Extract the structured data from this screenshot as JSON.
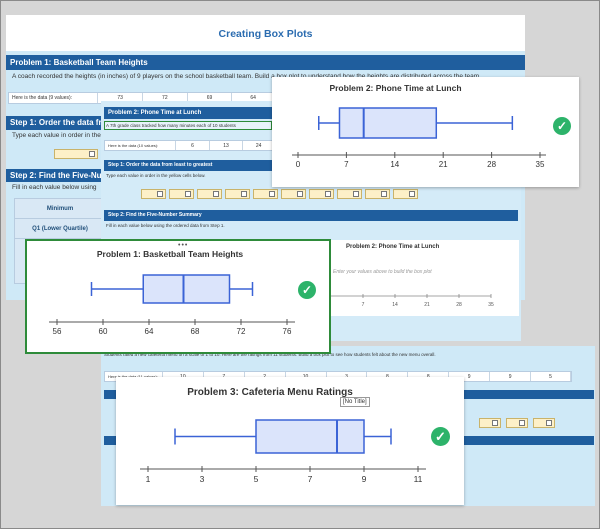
{
  "main_sheet": {
    "title": "Creating Box Plots",
    "problem1_header": "Problem 1: Basketball Team Heights",
    "problem1_desc": "A coach recorded the heights (in inches) of 9 players on the school basketball team. Build a box plot to understand how the heights are distributed across the team.",
    "data_row": {
      "label": "Here is the data (9 values):",
      "values": [
        "73",
        "72",
        "69",
        "64"
      ]
    },
    "step1_header": "Step 1: Order the data from",
    "step1_text": "Type each value in order in the",
    "step2_header": "Step 2: Find the Five-Number",
    "step2_text": "Fill in each value below using",
    "summary_rows": [
      "Minimum",
      "Q1 (Lower Quartile)"
    ]
  },
  "problem2_sheet": {
    "header": "Problem 2: Phone Time at Lunch",
    "desc": "A 7th grade class tracked how many minutes each of 10 students",
    "data_row": {
      "label": "Here is the data (10 values):",
      "values": [
        "6",
        "13",
        "24"
      ]
    },
    "step1_header": "Step 1: Order the data from least to greatest",
    "step1_text": "Type each value in order in the yellow cells below.",
    "step2_header": "Step 2: Find the Five-Number Summary",
    "step2_text": "Fill in each value below using the ordered data from Step 1.",
    "preview_title": "Problem 2: Phone Time at Lunch",
    "preview_placeholder": "Enter your values above to build the box plot",
    "preview_ticks": [
      "7",
      "14",
      "21",
      "28",
      "35"
    ]
  },
  "problem3_sheet": {
    "desc": "Students rated a new cafeteria menu on a scale of 1 to 10. Here are the ratings from 11 students. Build a box plot to see how students felt about the new menu overall.",
    "data_row": {
      "label": "Here is the data (11 values):",
      "values": [
        "10",
        "7",
        "2",
        "10",
        "3",
        "8",
        "8",
        "9",
        "9",
        "5"
      ]
    }
  },
  "popup_p2": {
    "title": "Problem 2: Phone Time at Lunch",
    "ticks": [
      "0",
      "7",
      "14",
      "21",
      "28",
      "35"
    ]
  },
  "popup_p1": {
    "title": "Problem 1: Basketball Team Heights",
    "ticks": [
      "56",
      "60",
      "64",
      "68",
      "72",
      "76"
    ]
  },
  "popup_p3": {
    "title": "Problem 3: Cafeteria Menu Ratings",
    "tooltip": "[No Title]",
    "ticks": [
      "1",
      "3",
      "5",
      "7",
      "9",
      "11"
    ]
  },
  "colors": {
    "accent": "#1f5e9e",
    "box_fill": "#dbe4fb",
    "box_stroke": "#3b63d6",
    "check": "#2db36a",
    "highlight_border": "#2e8b3a"
  },
  "chart_data": [
    {
      "type": "boxplot",
      "title": "Problem 2: Phone Time at Lunch",
      "xlim": [
        0,
        35
      ],
      "min": 3,
      "q1": 6,
      "median": 9.5,
      "q3": 20,
      "max": 31
    },
    {
      "type": "boxplot",
      "title": "Problem 1: Basketball Team Heights",
      "xlim": [
        56,
        76
      ],
      "min": 59,
      "q1": 63.5,
      "median": 67,
      "q3": 71,
      "max": 73
    },
    {
      "type": "boxplot",
      "title": "Problem 3: Cafeteria Menu Ratings",
      "xlim": [
        1,
        11
      ],
      "min": 2,
      "q1": 5,
      "median": 8,
      "q3": 9,
      "max": 10
    }
  ]
}
